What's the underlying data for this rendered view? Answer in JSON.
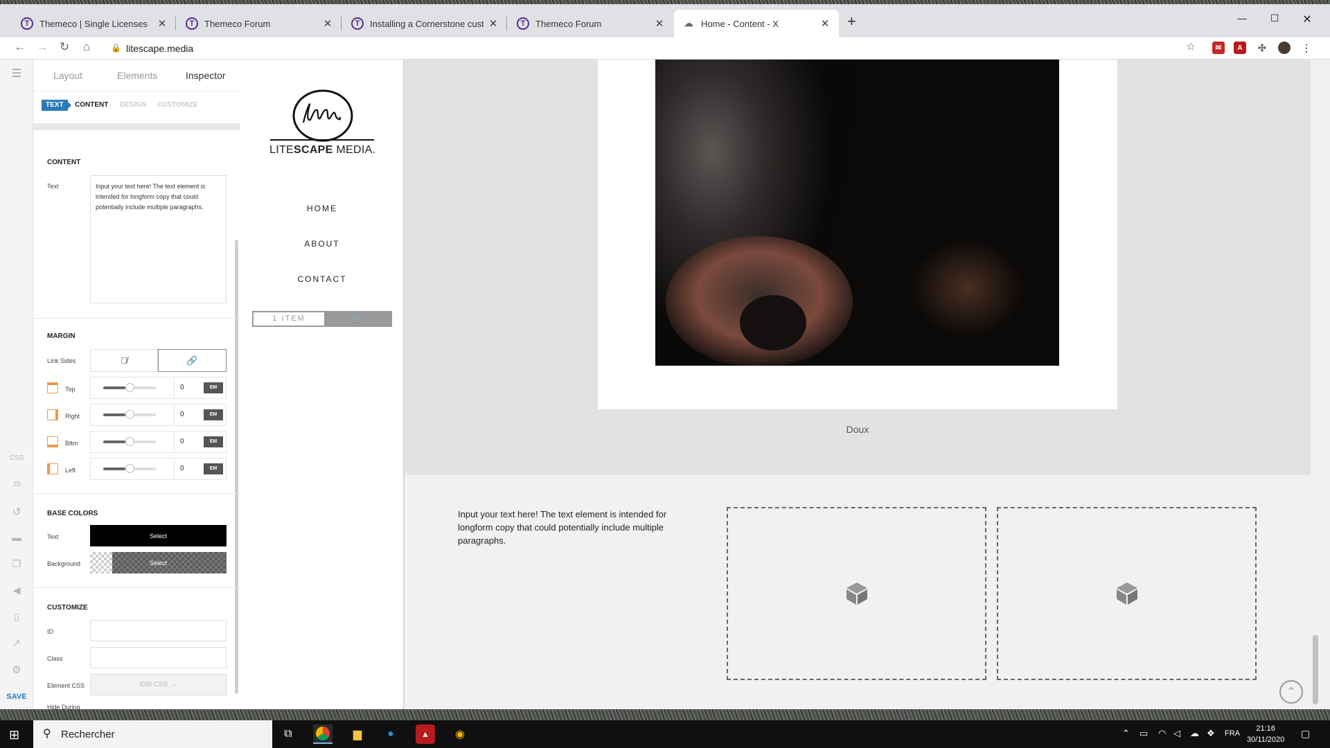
{
  "browser": {
    "tabs": [
      {
        "title": "Themeco | Single Licenses",
        "icon": "T"
      },
      {
        "title": "Themeco Forum",
        "icon": "T"
      },
      {
        "title": "Installing a Cornerstone custom",
        "icon": "T"
      },
      {
        "title": "Themeco Forum",
        "icon": "T"
      },
      {
        "title": "Home - Content - X",
        "icon": "☁"
      }
    ],
    "url": "litescape.media"
  },
  "builder": {
    "panel_tabs": [
      "Layout",
      "Elements",
      "Inspector"
    ],
    "sub_tabs": [
      "TEXT",
      "CONTENT",
      "DESIGN",
      "CUSTOMIZE"
    ],
    "content": {
      "title": "CONTENT",
      "text_label": "Text",
      "text_value": "Input your text here! The text element is intended for longform copy that could potentially include multiple paragraphs."
    },
    "margin": {
      "title": "MARGIN",
      "link_sides_label": "Link Sides",
      "rows": [
        {
          "label": "Top",
          "value": "0",
          "unit": "EM"
        },
        {
          "label": "Right",
          "value": "0",
          "unit": "EM"
        },
        {
          "label": "Bttm",
          "value": "0",
          "unit": "EM"
        },
        {
          "label": "Left",
          "value": "0",
          "unit": "EM"
        }
      ]
    },
    "base_colors": {
      "title": "BASE COLORS",
      "text_label": "Text",
      "background_label": "Background",
      "select_label": "Select"
    },
    "customize": {
      "title": "CUSTOMIZE",
      "id_label": "ID",
      "class_label": "Class",
      "element_css_label": "Element CSS",
      "edit_css_label": "Edit CSS →",
      "hide_during_label": "Hide During"
    },
    "strip": {
      "css": "CSS",
      "js": "JS",
      "save": "SAVE"
    }
  },
  "site": {
    "logo_text_light": "LITE",
    "logo_text_bold": "SCAPE",
    "logo_text_tail": " MEDIA.",
    "nav": [
      "HOME",
      "ABOUT",
      "CONTACT"
    ],
    "cart_label": "1 ITEM",
    "caption": "Doux",
    "body_text": "Input your text here! The text element is intended for longform copy that could potentially include multiple paragraphs."
  },
  "taskbar": {
    "search_placeholder": "Rechercher",
    "language": "FRA",
    "time": "21:16",
    "date": "30/11/2020"
  },
  "colors": {
    "accent": "#2a7ab8",
    "margin_icon": "#e89b4c",
    "tab_brand": "#5b2c8e"
  }
}
